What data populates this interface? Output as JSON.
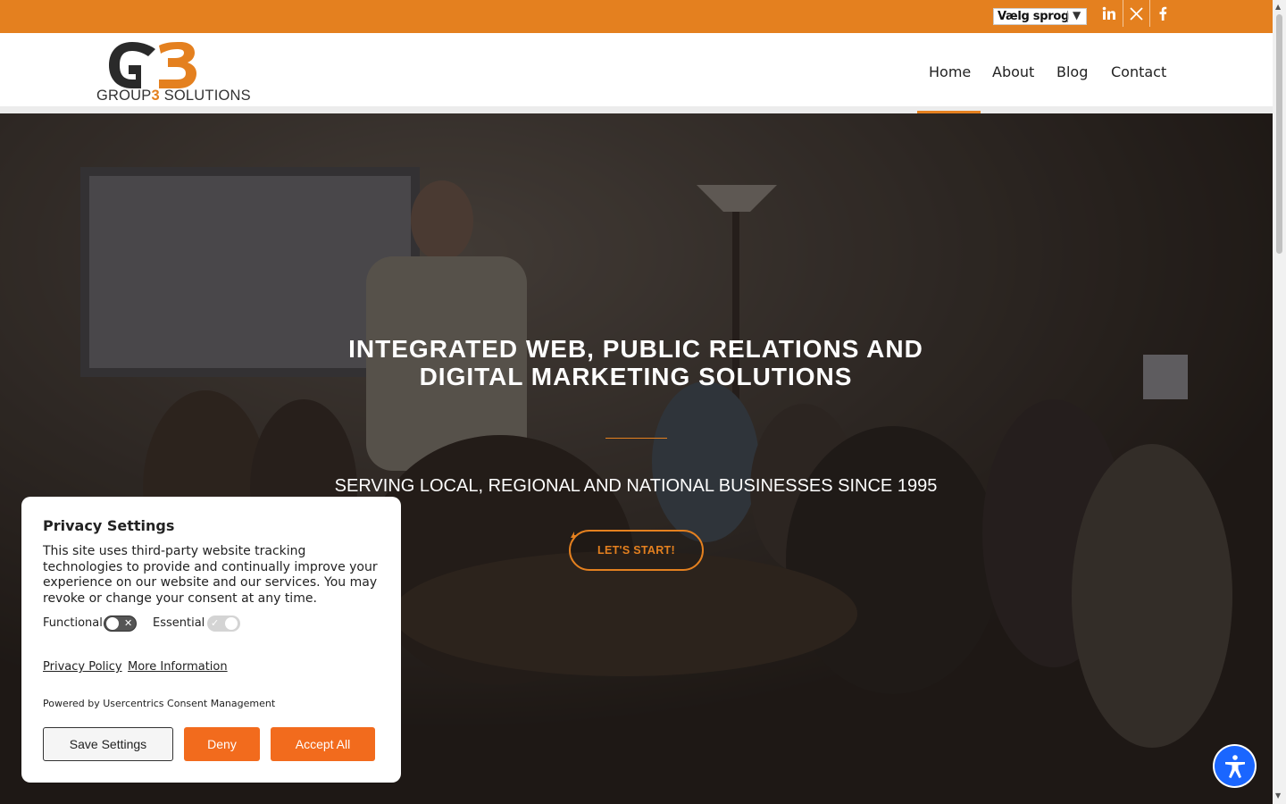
{
  "topbar": {
    "language_selector": "Vælg sprog",
    "social": [
      "linkedin-icon",
      "x-icon",
      "facebook-icon"
    ]
  },
  "logo": {
    "mark": "G3",
    "caption_prefix": "GROUP",
    "caption_number": "3",
    "caption_suffix": " SOLUTIONS"
  },
  "nav": {
    "items": [
      "Home",
      "About",
      "Blog",
      "Contact"
    ],
    "active": "Home"
  },
  "hero": {
    "title": "INTEGRATED WEB, PUBLIC RELATIONS AND DIGITAL MARKETING SOLUTIONS",
    "subtitle": "SERVING LOCAL, REGIONAL AND NATIONAL BUSINESSES SINCE 1995",
    "cta": "LET'S START!"
  },
  "privacy": {
    "title": "Privacy Settings",
    "body": "This site uses third-party website tracking technologies to provide and continually improve your experience on our website and our services. You may revoke or change your consent at any time.",
    "toggles": [
      {
        "label": "Functional",
        "state": "off"
      },
      {
        "label": "Essential",
        "state": "on-disabled"
      }
    ],
    "privacy_policy_link": "Privacy Policy",
    "more_info_link": "More Information",
    "powered_by": "Powered by Usercentrics Consent Management",
    "save_button": "Save Settings",
    "deny_button": "Deny",
    "accept_button": "Accept All"
  },
  "colors": {
    "brand_orange": "#e4801f",
    "consent_orange": "#f26b1d",
    "accessibility_blue": "#1a66ff"
  },
  "accessibility": {
    "icon": "accessibility-icon"
  }
}
